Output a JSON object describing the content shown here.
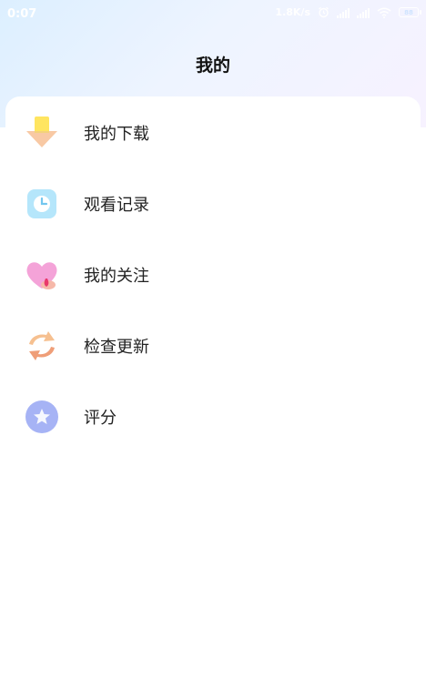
{
  "status_bar": {
    "time": "0:07",
    "speed": "1.8K/s",
    "battery": "88"
  },
  "header": {
    "title": "我的"
  },
  "menu": [
    {
      "label": "我的下载",
      "icon": "download-icon"
    },
    {
      "label": "观看记录",
      "icon": "clock-icon"
    },
    {
      "label": "我的关注",
      "icon": "heart-icon"
    },
    {
      "label": "检查更新",
      "icon": "refresh-icon"
    },
    {
      "label": "评分",
      "icon": "star-icon"
    }
  ]
}
